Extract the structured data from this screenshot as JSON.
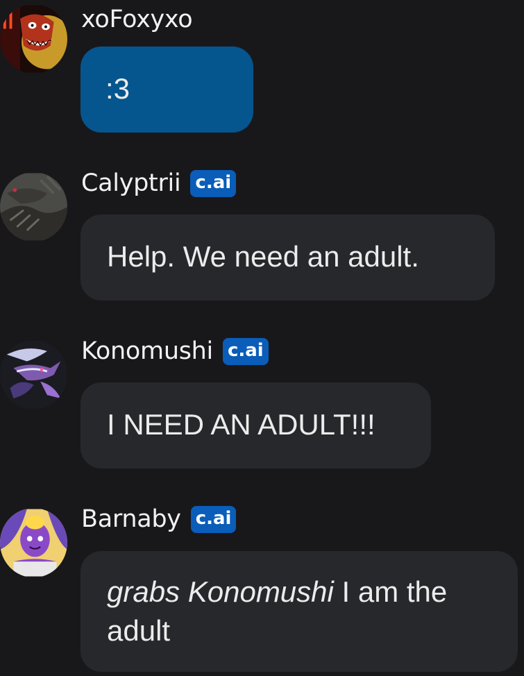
{
  "messages": [
    {
      "author": "xoFoxyxo",
      "badge": "",
      "text": ":3",
      "avatar_icon": "fox-character-avatar"
    },
    {
      "author": "Calyptrii",
      "badge": "c.ai",
      "text": "Help. We need an adult.",
      "avatar_icon": "dark-creature-avatar"
    },
    {
      "author": "Konomushi",
      "badge": "c.ai",
      "text": "I NEED AN ADULT!!!",
      "avatar_icon": "purple-dragon-avatar"
    },
    {
      "author": "Barnaby",
      "badge": "c.ai",
      "text_italic": "grabs Konomushi",
      "text_rest": " I am the adult",
      "avatar_icon": "purple-clown-avatar"
    }
  ],
  "colors": {
    "background": "#18181b",
    "user_bubble": "#05558f",
    "bot_bubble": "#27282c",
    "badge": "#0a5db8"
  }
}
